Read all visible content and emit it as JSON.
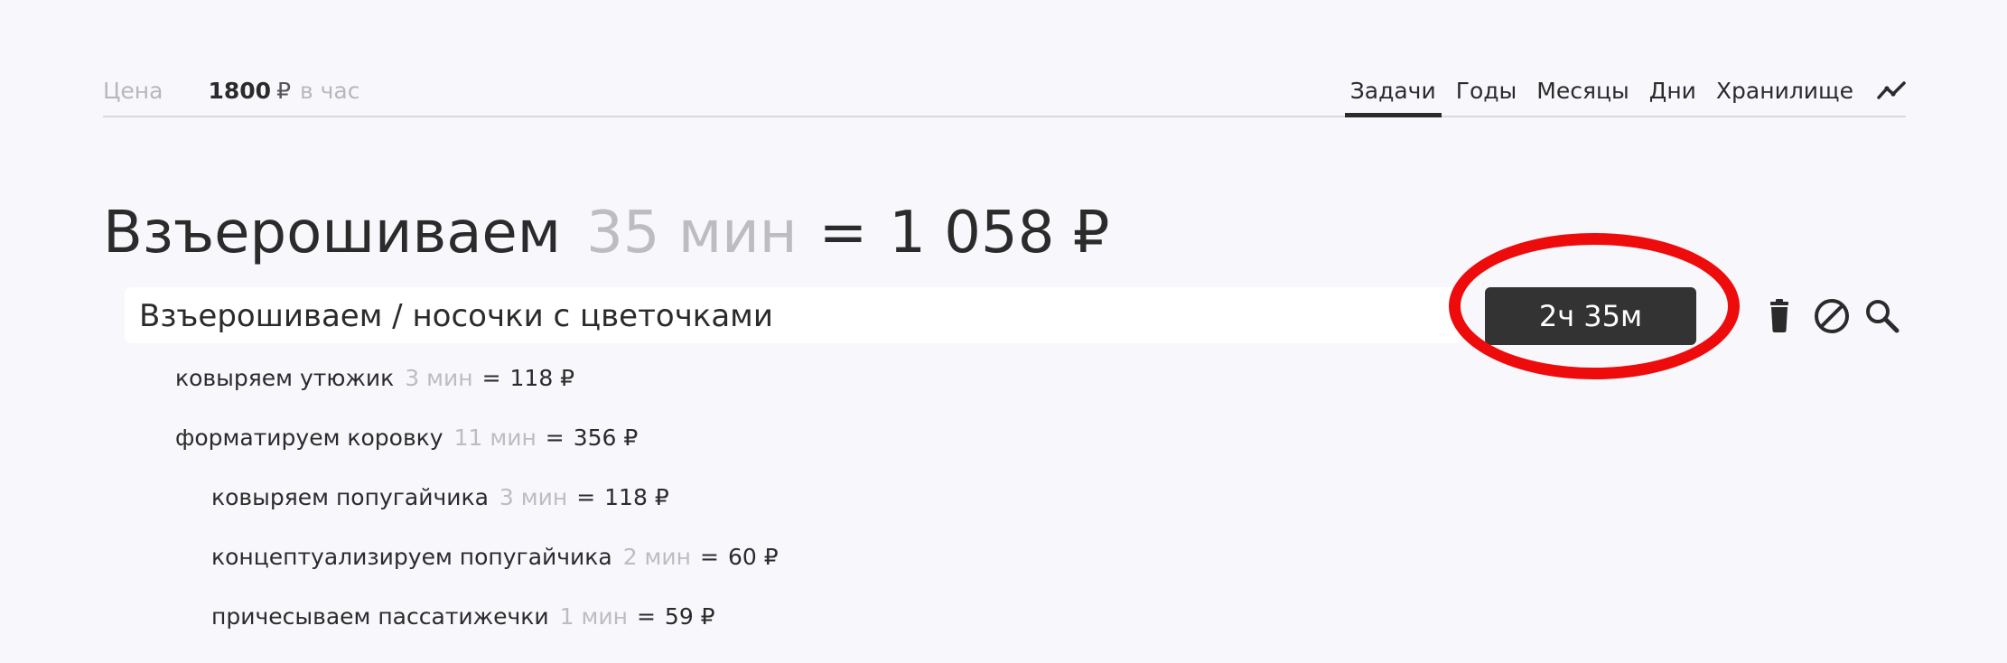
{
  "header": {
    "price_label": "Цена",
    "price_value": "1800",
    "currency": "₽",
    "per_unit": "в час"
  },
  "tabs": [
    {
      "label": "Задачи",
      "active": true
    },
    {
      "label": "Годы",
      "active": false
    },
    {
      "label": "Месяцы",
      "active": false
    },
    {
      "label": "Дни",
      "active": false
    },
    {
      "label": "Хранилище",
      "active": false
    }
  ],
  "icons": {
    "trend": "trend-line-icon",
    "delete": "trash-icon",
    "block": "block-icon",
    "search": "search-icon"
  },
  "project": {
    "name": "Взъерошиваем",
    "duration": "35 мин",
    "equals": "=",
    "total": "1 058 ₽"
  },
  "task": {
    "value": "Взъерошиваем / носочки с цветочками",
    "timer": "2ч 35м"
  },
  "subtasks": [
    {
      "name": "ковыряем утюжик",
      "duration": "3 мин",
      "equals": "=",
      "amount": "118 ₽",
      "level": 1
    },
    {
      "name": "форматируем коровку",
      "duration": "11 мин",
      "equals": "=",
      "amount": "356 ₽",
      "level": 1
    },
    {
      "name": "ковыряем попугайчика",
      "duration": "3 мин",
      "equals": "=",
      "amount": "118 ₽",
      "level": 2
    },
    {
      "name": "концептуализируем попугайчика",
      "duration": "2 мин",
      "equals": "=",
      "amount": "60 ₽",
      "level": 2
    },
    {
      "name": "причесываем пассатижечки",
      "duration": "1 мин",
      "equals": "=",
      "amount": "59 ₽",
      "level": 2
    }
  ],
  "colors": {
    "background": "#f8f8fc",
    "text": "#2b2b2b",
    "muted": "#bdbdc1",
    "timer_bg": "#333333",
    "highlight": "#ee0b0b"
  }
}
